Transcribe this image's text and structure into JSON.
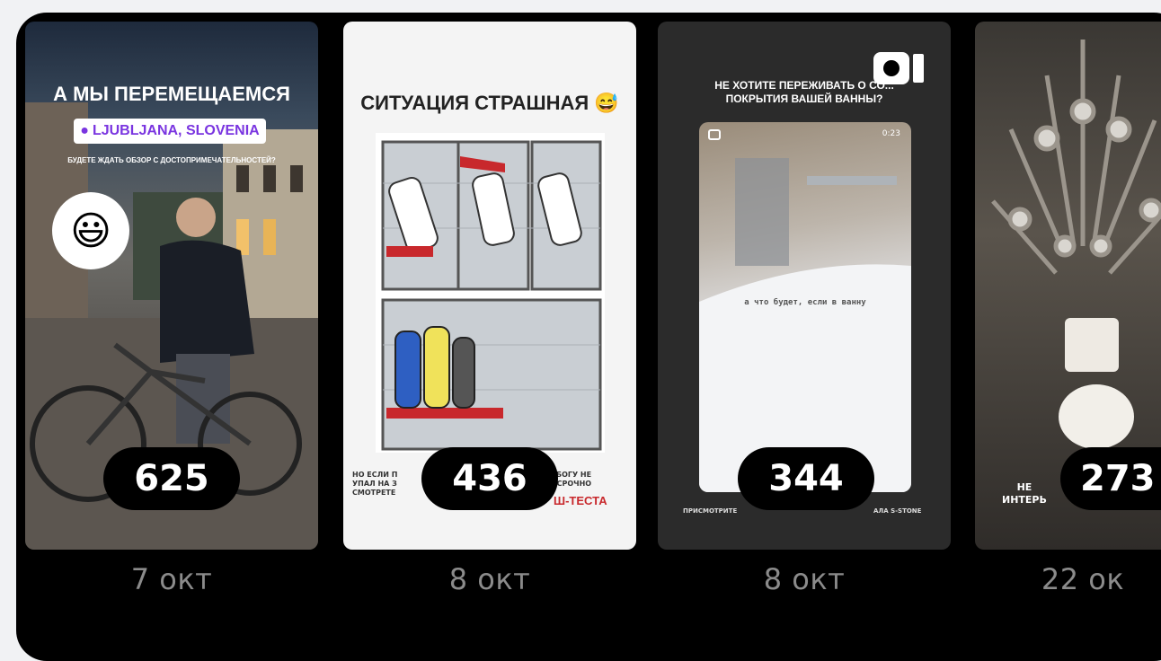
{
  "stories": [
    {
      "count": "625",
      "date": "7 окт",
      "headline": "А МЫ ПЕРЕМЕЩАЕМСЯ",
      "location_tag": "LJUBLJANA, SLOVENIA",
      "subtext": "БУДЕТЕ ЖДАТЬ ОБЗОР С ДОСТОПРИМЕЧАТЕЛЬНОСТЕЙ?",
      "sticker": "😃"
    },
    {
      "count": "436",
      "date": "8 окт",
      "headline": "СИТУАЦИЯ СТРАШНАЯ 😅",
      "bottom_left": "НО ЕСЛИ П\nУПАЛ НА З\nСМОТРЕТЕ",
      "bottom_right": "А БОГУ НЕ\nО СРОЧНО",
      "bottom_red": "Ш-ТЕСТА"
    },
    {
      "count": "344",
      "date": "8 окт",
      "headline": "НЕ ХОТИТЕ ПЕРЕЖИВАТЬ О СО... ПОКРЫТИЯ ВАШЕЙ ВАННЫ?",
      "video_caption": "а что будет, если в ванну",
      "timer": "0:23",
      "bottom_left": "ПРИСМОТРИТЕ",
      "bottom_right": "АЛА S-STONE"
    },
    {
      "count": "273",
      "date": "22 ок",
      "bottom_text": "НЕ\nИНТЕРЬ"
    }
  ]
}
